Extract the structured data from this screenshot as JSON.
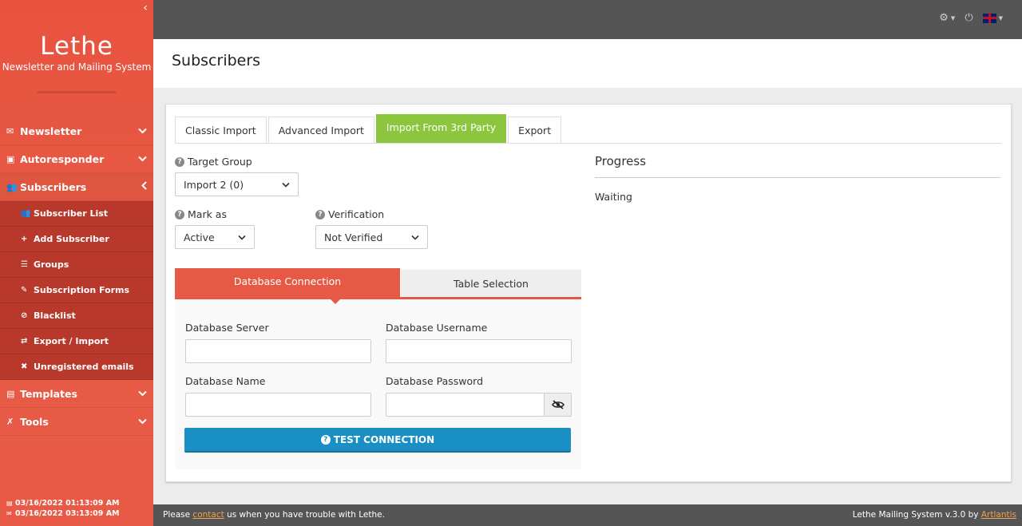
{
  "app": {
    "title": "Lethe",
    "subtitle": "Newsletter and Mailing System"
  },
  "sidebar": {
    "collapse_icon": "chevron-left-icon",
    "menu": [
      {
        "label": "Newsletter",
        "icon": "envelope-icon"
      },
      {
        "label": "Autoresponder",
        "icon": "robot-icon"
      },
      {
        "label": "Subscribers",
        "icon": "users-icon"
      },
      {
        "label": "Templates",
        "icon": "paint-roller-icon"
      },
      {
        "label": "Tools",
        "icon": "tools-icon"
      }
    ],
    "submenu": [
      {
        "label": "Subscriber List",
        "icon": "users-icon"
      },
      {
        "label": "Add Subscriber",
        "icon": "plus-icon"
      },
      {
        "label": "Groups",
        "icon": "list-icon"
      },
      {
        "label": "Subscription Forms",
        "icon": "edit-icon"
      },
      {
        "label": "Blacklist",
        "icon": "ban-icon"
      },
      {
        "label": "Export / Import",
        "icon": "exchange-icon"
      },
      {
        "label": "Unregistered emails",
        "icon": "user-slash-icon"
      }
    ],
    "footer": {
      "date1": "03/16/2022 01:13:09 AM",
      "date2": "03/16/2022 03:13:09 AM"
    }
  },
  "page": {
    "title": "Subscribers"
  },
  "tabs": [
    "Classic Import",
    "Advanced Import",
    "Import From 3rd Party",
    "Export"
  ],
  "form": {
    "target_group_label": "Target Group",
    "target_group_value": "Import 2 (0)",
    "mark_as_label": "Mark as",
    "mark_as_value": "Active",
    "verification_label": "Verification",
    "verification_value": "Not Verified"
  },
  "progress": {
    "title": "Progress",
    "status": "Waiting"
  },
  "db": {
    "tab_connection": "Database Connection",
    "tab_table": "Table Selection",
    "server_label": "Database Server",
    "username_label": "Database Username",
    "name_label": "Database Name",
    "password_label": "Database Password",
    "test_button": "TEST CONNECTION"
  },
  "footer": {
    "left_prefix": "Please",
    "left_link": "contact",
    "left_suffix": "us when you have trouble with Lethe.",
    "right_prefix": "Lethe Mailing System v.3.0 by",
    "right_link": "Artlantis"
  },
  "colors": {
    "sidebar": "#e65a45",
    "active_tab": "#8cc63f",
    "db_accent": "#e65a45",
    "button": "#1a8fc4",
    "topbar": "#555555"
  }
}
